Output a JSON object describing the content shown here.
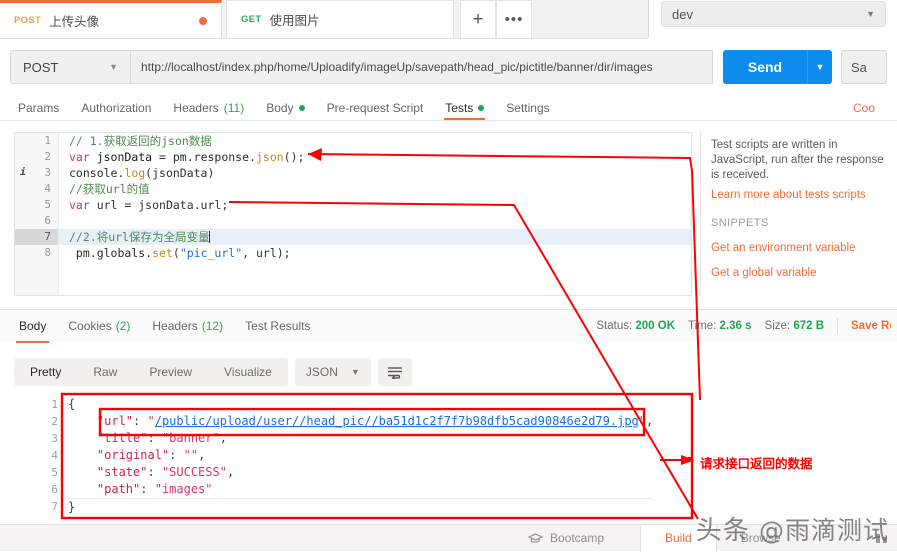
{
  "tabs": {
    "items": [
      {
        "method": "POST",
        "name": "上传头像",
        "unsaved": true,
        "active": true
      },
      {
        "method": "GET",
        "name": "使用图片",
        "unsaved": false,
        "active": false
      }
    ],
    "new_tab_label": "+",
    "more_label": "•••"
  },
  "environment": {
    "selected": "dev",
    "caret": "▼"
  },
  "request": {
    "method": "POST",
    "method_caret": "▼",
    "url": "http://localhost/index.php/home/Uploadify/imageUp/savepath/head_pic/pictitle/banner/dir/images",
    "send_label": "Send",
    "send_caret": "▼",
    "save_label": "Sa",
    "tabs": [
      {
        "label": "Params",
        "active": false
      },
      {
        "label": "Authorization",
        "active": false
      },
      {
        "label": "Headers",
        "count": "(11)",
        "active": false
      },
      {
        "label": "Body",
        "dot": true,
        "active": false
      },
      {
        "label": "Pre-request Script",
        "active": false
      },
      {
        "label": "Tests",
        "dot": true,
        "active": true
      },
      {
        "label": "Settings",
        "active": false
      }
    ],
    "cookies_link": "Coo"
  },
  "editor": {
    "lines": [
      {
        "n": "1",
        "marker": "",
        "highlight": false,
        "tokens": [
          {
            "t": "// 1.获取返回的json数据",
            "c": "cmt"
          }
        ]
      },
      {
        "n": "2",
        "marker": "",
        "highlight": false,
        "tokens": [
          {
            "t": "var ",
            "c": "kw"
          },
          {
            "t": "jsonData ",
            "c": "vr"
          },
          {
            "t": "= ",
            "c": "pun"
          },
          {
            "t": "pm.response.",
            "c": "fn"
          },
          {
            "t": "json",
            "c": "mth"
          },
          {
            "t": "();",
            "c": "pun"
          }
        ]
      },
      {
        "n": "3",
        "marker": "i",
        "highlight": false,
        "tokens": [
          {
            "t": "console.",
            "c": "fn"
          },
          {
            "t": "log",
            "c": "mth"
          },
          {
            "t": "(jsonData)",
            "c": "pun"
          }
        ]
      },
      {
        "n": "4",
        "marker": "",
        "highlight": false,
        "tokens": [
          {
            "t": "//获取url的值",
            "c": "cmt"
          }
        ]
      },
      {
        "n": "5",
        "marker": "",
        "highlight": false,
        "tokens": [
          {
            "t": "var ",
            "c": "kw"
          },
          {
            "t": "url = jsonData.url;",
            "c": "pun"
          }
        ]
      },
      {
        "n": "6",
        "marker": "",
        "highlight": false,
        "tokens": [
          {
            "t": "",
            "c": "pun"
          }
        ]
      },
      {
        "n": "7",
        "marker": "",
        "highlight": true,
        "tokens": [
          {
            "t": "//2.将url保存为全局变量",
            "c": "cmt"
          },
          {
            "t": "CARET",
            "c": "caret"
          }
        ]
      },
      {
        "n": "8",
        "marker": "",
        "highlight": false,
        "tokens": [
          {
            "t": " pm.globals.",
            "c": "fn"
          },
          {
            "t": "set",
            "c": "mth"
          },
          {
            "t": "(",
            "c": "pun"
          },
          {
            "t": "\"pic_url\"",
            "c": "str"
          },
          {
            "t": ", url);",
            "c": "pun"
          }
        ]
      }
    ]
  },
  "info_panel": {
    "description": "Test scripts are written in JavaScript, run after the response is received.",
    "learn_more": "Learn more about tests scripts",
    "snippets_label": "SNIPPETS",
    "snippets": [
      "Get an environment variable",
      "Get a global variable"
    ]
  },
  "response": {
    "tabs": [
      {
        "label": "Body",
        "active": true
      },
      {
        "label": "Cookies",
        "count": "(2)",
        "active": false
      },
      {
        "label": "Headers",
        "count": "(12)",
        "active": false
      },
      {
        "label": "Test Results",
        "active": false
      }
    ],
    "meta": {
      "status_key": "Status:",
      "status_value": "200 OK",
      "time_key": "Time:",
      "time_value": "2.36 s",
      "size_key": "Size:",
      "size_value": "672 B",
      "save_response": "Save Res"
    },
    "view_modes": [
      {
        "label": "Pretty",
        "active": true
      },
      {
        "label": "Raw",
        "active": false
      },
      {
        "label": "Preview",
        "active": false
      },
      {
        "label": "Visualize",
        "active": false
      }
    ],
    "format": {
      "value": "JSON",
      "caret": "▼"
    },
    "wrap_icon": "wrap-lines-icon",
    "body_lines": [
      {
        "n": "1",
        "tokens": [
          {
            "t": "{",
            "c": "jpun"
          }
        ]
      },
      {
        "n": "2",
        "tokens": [
          {
            "t": "    ",
            "c": "jpun"
          },
          {
            "t": "\"url\"",
            "c": "jkey"
          },
          {
            "t": ": ",
            "c": "jpun"
          },
          {
            "t": "\"",
            "c": "jstr"
          },
          {
            "t": "/public/upload/user//head_pic//ba51d1c2f7f7b98dfb5cad90846e2d79.jpg",
            "c": "jlink"
          },
          {
            "t": "\"",
            "c": "jstr"
          },
          {
            "t": ",",
            "c": "jpun"
          }
        ]
      },
      {
        "n": "3",
        "tokens": [
          {
            "t": "    ",
            "c": "jpun"
          },
          {
            "t": "\"title\"",
            "c": "jkey"
          },
          {
            "t": ": ",
            "c": "jpun"
          },
          {
            "t": "\"banner\"",
            "c": "jstr"
          },
          {
            "t": ",",
            "c": "jpun"
          }
        ]
      },
      {
        "n": "4",
        "tokens": [
          {
            "t": "    ",
            "c": "jpun"
          },
          {
            "t": "\"original\"",
            "c": "jkey"
          },
          {
            "t": ": ",
            "c": "jpun"
          },
          {
            "t": "\"\"",
            "c": "jstr"
          },
          {
            "t": ",",
            "c": "jpun"
          }
        ]
      },
      {
        "n": "5",
        "tokens": [
          {
            "t": "    ",
            "c": "jpun"
          },
          {
            "t": "\"state\"",
            "c": "jkey"
          },
          {
            "t": ": ",
            "c": "jpun"
          },
          {
            "t": "\"SUCCESS\"",
            "c": "jstr"
          },
          {
            "t": ",",
            "c": "jpun"
          }
        ]
      },
      {
        "n": "6",
        "tokens": [
          {
            "t": "    ",
            "c": "jpun"
          },
          {
            "t": "\"path\"",
            "c": "jkey"
          },
          {
            "t": ": ",
            "c": "jpun"
          },
          {
            "t": "\"images\"",
            "c": "jstr"
          }
        ]
      },
      {
        "n": "7",
        "tokens": [
          {
            "t": "}",
            "c": "jpun"
          }
        ]
      }
    ]
  },
  "annotations": {
    "callout_text": "请求接口返回的数据",
    "color": "#ff0000"
  },
  "bottom_bar": {
    "bootcamp_label": "Bootcamp",
    "build_label": "Build",
    "browse_label": "Browse"
  },
  "watermark": {
    "prefix": "头条",
    "handle": "@雨滴测试"
  }
}
